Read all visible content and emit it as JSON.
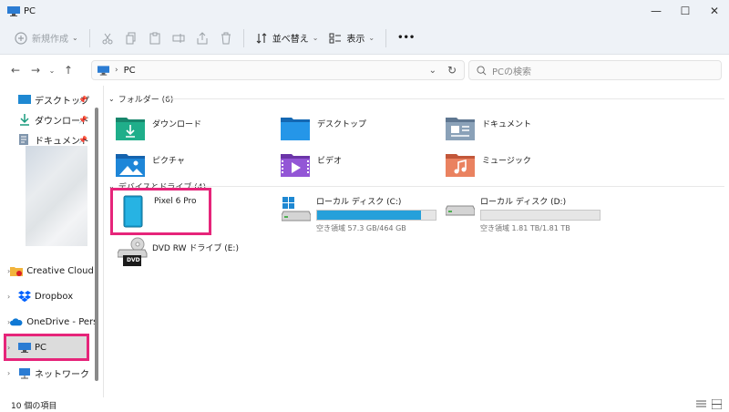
{
  "window": {
    "title": "PC",
    "minimize": "—",
    "maximize": "☐",
    "close": "✕"
  },
  "toolbar": {
    "new_label": "新規作成",
    "sort_label": "並べ替え",
    "view_label": "表示",
    "more": "•••"
  },
  "address": {
    "crumb": "PC",
    "search_placeholder": "PCの検索"
  },
  "sidebar": {
    "quick": [
      {
        "label": "デスクトップ"
      },
      {
        "label": "ダウンロード"
      },
      {
        "label": "ドキュメント"
      }
    ],
    "tree": [
      {
        "label": "Creative Cloud Fi"
      },
      {
        "label": "Dropbox"
      },
      {
        "label": "OneDrive - Perso"
      },
      {
        "label": "PC"
      },
      {
        "label": "ネットワーク"
      }
    ]
  },
  "groups": {
    "folders_header": "フォルダー (6)",
    "devices_header": "デバイスとドライブ (4)"
  },
  "folders": [
    {
      "label": "ダウンロード",
      "icon": "download-folder-icon",
      "color": "#1a9b7e"
    },
    {
      "label": "デスクトップ",
      "icon": "desktop-folder-icon",
      "color": "#1e88d2"
    },
    {
      "label": "ドキュメント",
      "icon": "documents-folder-icon",
      "color": "#8096ad"
    },
    {
      "label": "ピクチャ",
      "icon": "pictures-folder-icon",
      "color": "#1e7fd0"
    },
    {
      "label": "ビデオ",
      "icon": "videos-folder-icon",
      "color": "#8a4fc8"
    },
    {
      "label": "ミュージック",
      "icon": "music-folder-icon",
      "color": "#e3734f"
    }
  ],
  "devices": [
    {
      "label": "Pixel 6 Pro"
    },
    {
      "label": "ローカル ディスク (C:)",
      "sub": "空き領域 57.3 GB/464 GB",
      "used_fraction": 0.876
    },
    {
      "label": "ローカル ディスク (D:)",
      "sub": "空き領域 1.81 TB/1.81 TB",
      "used_fraction": 0.0
    },
    {
      "label": "DVD RW ドライブ (E:)",
      "badge": "DVD"
    }
  ],
  "status": {
    "count": "10 個の項目"
  },
  "colors": {
    "accent": "#26a0da",
    "highlight": "#e6257a"
  }
}
